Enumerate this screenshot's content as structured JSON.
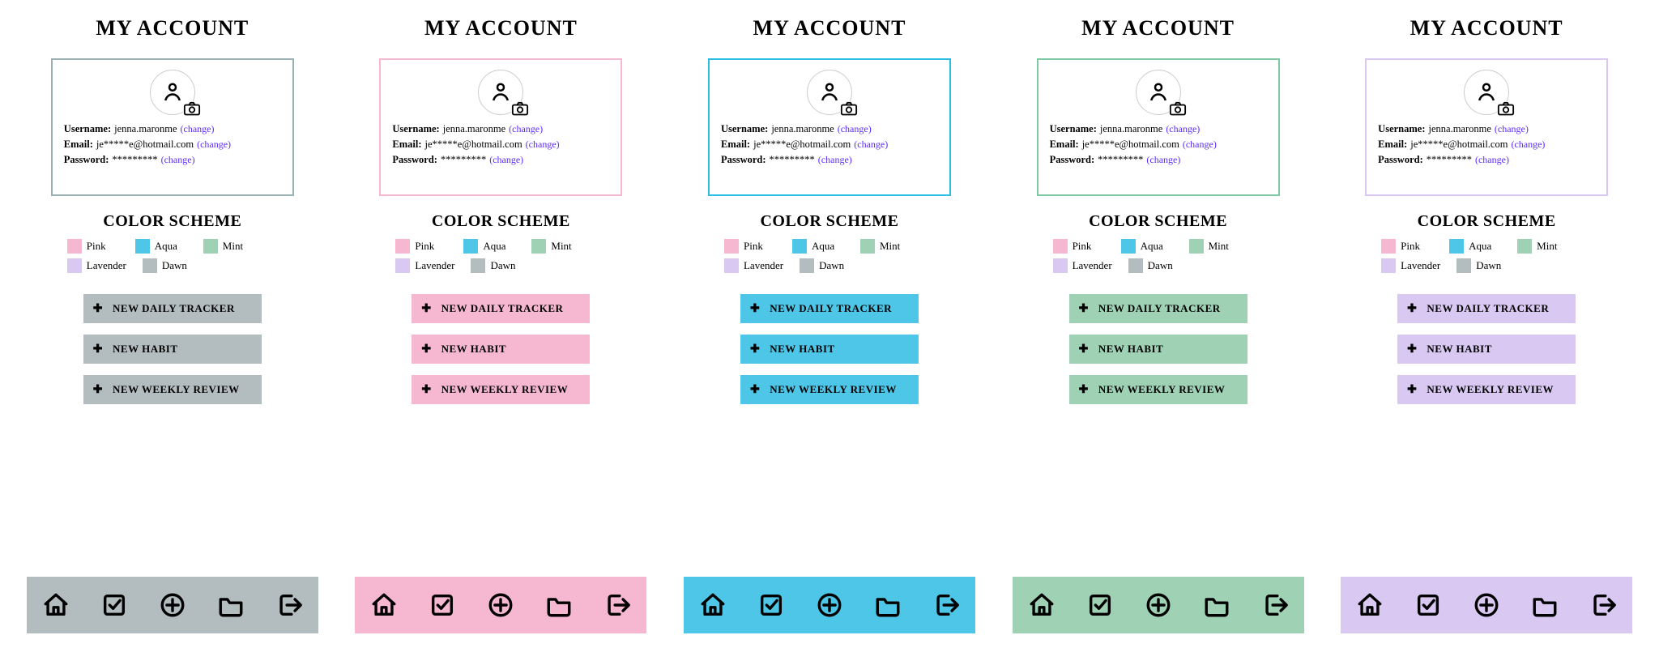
{
  "title": "MY ACCOUNT",
  "fields": {
    "username_label": "Username:",
    "username_value": "jenna.maronme",
    "email_label": "Email:",
    "email_value": "je*****e@hotmail.com",
    "password_label": "Password:",
    "password_value": "*********",
    "change": "(change)"
  },
  "color_scheme_title": "COLOR SCHEME",
  "swatches": [
    {
      "name": "Pink",
      "hex": "#f6b8d0"
    },
    {
      "name": "Aqua",
      "hex": "#4ec6e8"
    },
    {
      "name": "Mint",
      "hex": "#9fd2b4"
    },
    {
      "name": "Lavender",
      "hex": "#d9c8f2"
    },
    {
      "name": "Dawn",
      "hex": "#b3bcbf"
    }
  ],
  "actions": [
    "NEW DAILY TRACKER",
    "NEW HABIT",
    "NEW WEEKLY REVIEW"
  ],
  "variants": [
    {
      "accent": "#b3bcbf",
      "border": "#9ab0b2",
      "name": "dawn"
    },
    {
      "accent": "#f6b8d0",
      "border": "#f6b8d0",
      "name": "pink"
    },
    {
      "accent": "#4ec6e8",
      "border": "#27bfe6",
      "name": "aqua"
    },
    {
      "accent": "#9fd2b4",
      "border": "#7cc9a3",
      "name": "mint"
    },
    {
      "accent": "#d9c8f2",
      "border": "#d9c8f2",
      "name": "lavender"
    }
  ],
  "nav_icons": [
    "home",
    "task",
    "add",
    "folder",
    "logout"
  ]
}
